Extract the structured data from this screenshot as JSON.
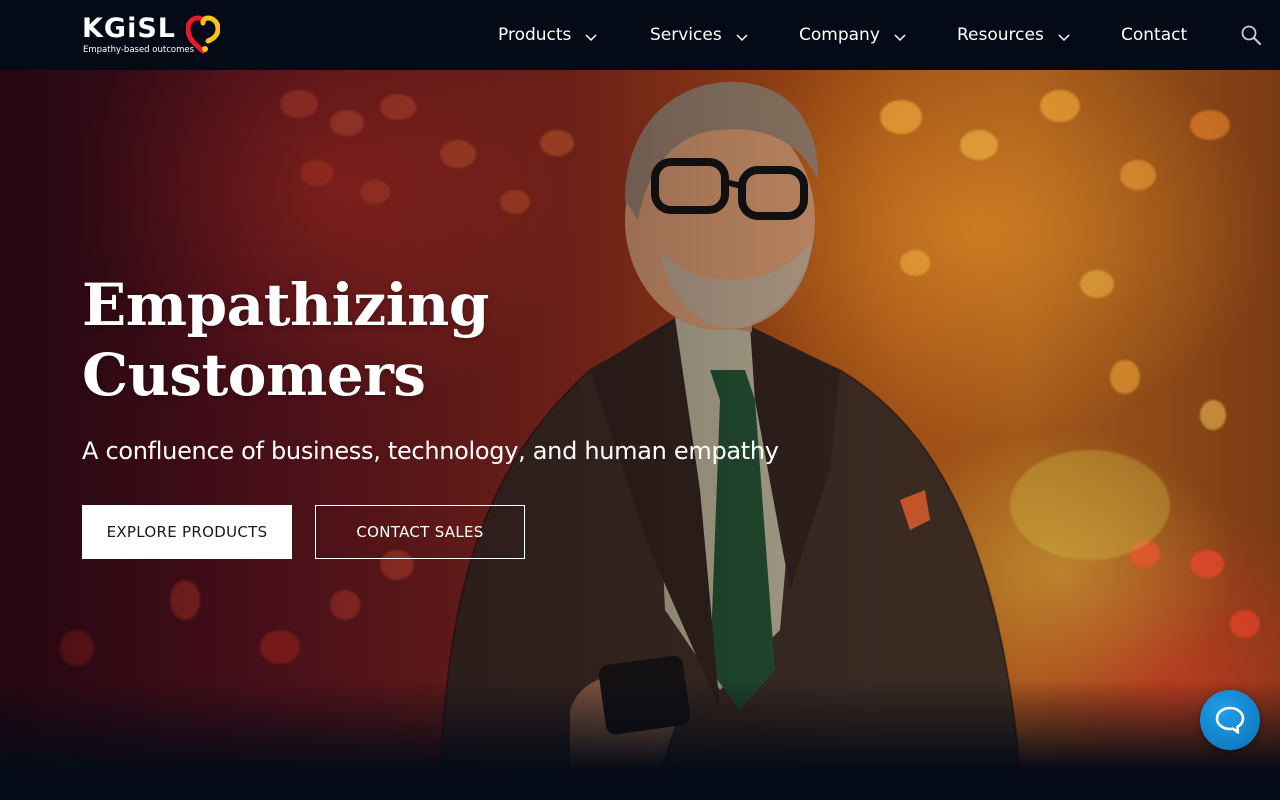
{
  "brand": {
    "name": "KGiSL",
    "tagline": "Empathy-based outcomes",
    "heart_colors": [
      "#e6192e",
      "#f7c21a"
    ]
  },
  "nav": {
    "items": [
      {
        "label": "Products",
        "has_dropdown": true
      },
      {
        "label": "Services",
        "has_dropdown": true
      },
      {
        "label": "Company",
        "has_dropdown": true
      },
      {
        "label": "Resources",
        "has_dropdown": true
      },
      {
        "label": "Contact",
        "has_dropdown": false
      }
    ],
    "search_icon": "search-icon"
  },
  "hero": {
    "title_line1": "Empathizing",
    "title_line2": "Customers",
    "subtitle": "A confluence of business, technology, and human empathy",
    "primary_button": "EXPLORE PRODUCTS",
    "secondary_button": "CONTACT SALES"
  },
  "chat": {
    "icon": "chat-bubble-icon",
    "color": "#0a86d0"
  },
  "colors": {
    "header_bg": "#040b17",
    "page_bg": "#050b16"
  }
}
